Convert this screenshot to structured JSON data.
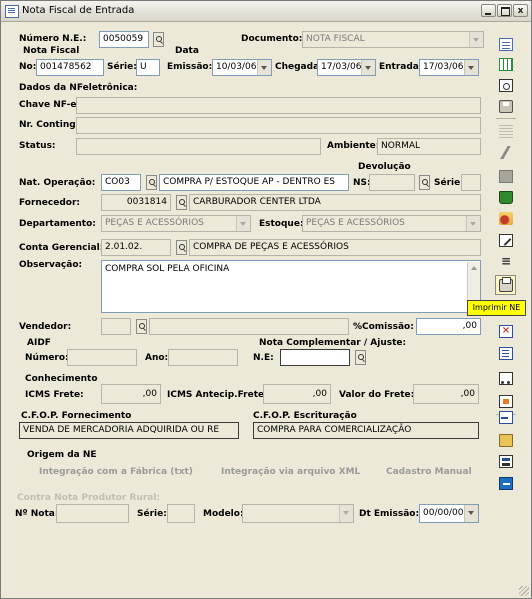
{
  "window": {
    "title": "Nota Fiscal de Entrada",
    "min_icon": "minimize-icon",
    "max_icon": "maximize-icon",
    "close_label": "x"
  },
  "header": {
    "numero_ne_label": "Número N.E.:",
    "numero_ne_value": "0050059",
    "documento_label": "Documento:",
    "documento_value": "NOTA FISCAL",
    "nota_fiscal_label": "Nota Fiscal",
    "no_label": "No:",
    "no_value": "001478562",
    "serie_label": "Série:",
    "serie_value": "U",
    "data_label": "Data",
    "emissao_label": "Emissão:",
    "emissao_value": "10/03/06",
    "chegada_label": "Chegada:",
    "chegada_value": "17/03/06",
    "entrada_label": "Entrada:",
    "entrada_value": "17/03/06"
  },
  "nfe": {
    "section_label": "Dados da NFeletrônica:",
    "chave_label": "Chave NF-e:",
    "chave_value": "",
    "contig_label": "Nr. Conting.:",
    "contig_value": "",
    "status_label": "Status:",
    "status_value": "",
    "ambiente_label": "Ambiente:",
    "ambiente_value": "NORMAL"
  },
  "operacao": {
    "nat_label": "Nat. Operação:",
    "nat_code": "CO03",
    "nat_desc": "COMPRA P/ ESTOQUE AP - DENTRO ES",
    "devolucao_label": "Devolução",
    "ns_label": "NS:",
    "ns_value": "",
    "serie_label": "Série:",
    "serie_value": "",
    "fornecedor_label": "Fornecedor:",
    "fornecedor_code": "0031814",
    "fornecedor_name": "CARBURADOR  CENTER  LTDA",
    "departamento_label": "Departamento:",
    "departamento_value": "PEÇAS E ACESSÓRIOS",
    "estoque_label": "Estoque:",
    "estoque_value": "PEÇAS E ACESSÓRIOS",
    "conta_label": "Conta Gerencial:",
    "conta_code": "2.01.02.",
    "conta_desc": "COMPRA DE PEÇAS E ACESSÓRIOS",
    "obs_label": "Observação:",
    "obs_value": "COMPRA SOL PELA OFICINA",
    "vendedor_label": "Vendedor:",
    "vendedor_code": "",
    "vendedor_name": "",
    "comissao_label": "%Comissão:",
    "comissao_value": ",00"
  },
  "aidf": {
    "section_label": "AIDF",
    "numero_label": "Número:",
    "numero_value": "",
    "ano_label": "Ano:",
    "ano_value": ""
  },
  "complementar": {
    "section_label": "Nota Complementar / Ajuste:",
    "ne_label": "N.E:",
    "ne_value": ""
  },
  "conhecimento": {
    "section_label": "Conhecimento",
    "icms_frete_label": "ICMS Frete:",
    "icms_frete_value": ",00",
    "icms_antecip_label": "ICMS Antecip.Frete:",
    "icms_antecip_value": ",00",
    "valor_frete_label": "Valor do Frete:",
    "valor_frete_value": ",00"
  },
  "cfop": {
    "fornecimento_label": "C.F.O.P. Fornecimento",
    "fornecimento_value": "VENDA DE MERCADORIA ADQUIRIDA OU RE",
    "escrituracao_label": "C.F.O.P. Escrituração",
    "escrituracao_value": "COMPRA PARA COMERCIALIZAÇÃO"
  },
  "origem": {
    "section_label": "Origem da NE",
    "options": [
      "Integração com a Fábrica (txt)",
      "Integração via arquivo XML",
      "Cadastro Manual"
    ]
  },
  "produtor": {
    "section_label": "Contra Nota Produtor Rural:",
    "nota_label": "Nº Nota:",
    "nota_value": "",
    "serie_label": "Série:",
    "serie_value": "",
    "modelo_label": "Modelo:",
    "modelo_value": "",
    "dt_emissao_label": "Dt Emissão:",
    "dt_emissao_value": "00/00/00"
  },
  "observacao_scroll_value": ",00",
  "tooltip": {
    "text": "Imprimir NE"
  },
  "toolbar": [
    "new-document-icon",
    "spreadsheet-icon",
    "preview-icon",
    "print-setup-icon",
    "list-icon",
    "lightning-icon",
    "calculator-icon",
    "delete-icon",
    "filter-icon",
    "edit-icon",
    "sum-icon",
    "print-icon",
    "document-x-icon",
    "document-edit-icon",
    "truck-icon",
    "note-icon",
    "import-icon",
    "folder-open-icon",
    "database-icon",
    "exit-icon"
  ],
  "colors": {
    "window_bg": "#ECE9D8",
    "field_border": "#7f9db9",
    "tooltip_bg": "#FFFF00"
  }
}
